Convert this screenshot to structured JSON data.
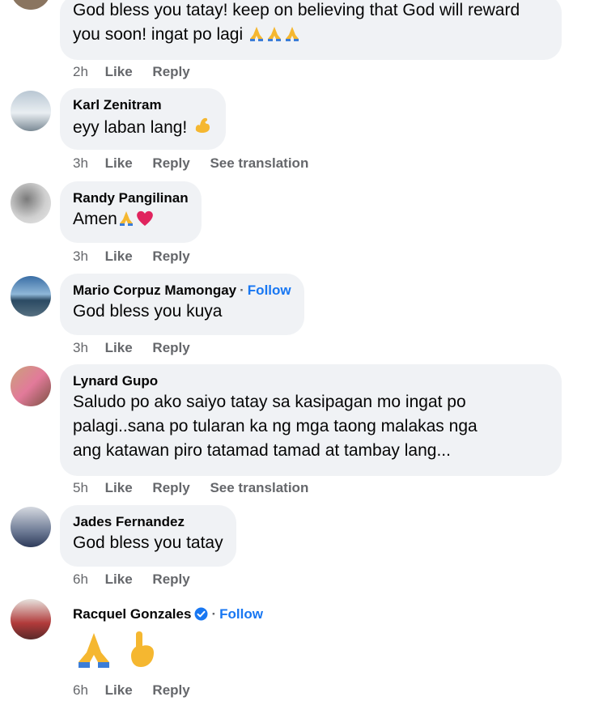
{
  "comments": [
    {
      "name": "",
      "text": "God bless you tatay! keep on believing that God will reward you soon! ingat po lagi",
      "time": "2h",
      "like": "Like",
      "reply": "Reply"
    },
    {
      "name": "Karl Zenitram",
      "text": "eyy laban lang!",
      "time": "3h",
      "like": "Like",
      "reply": "Reply",
      "translate": "See translation"
    },
    {
      "name": "Randy Pangilinan",
      "text": "Amen",
      "time": "3h",
      "like": "Like",
      "reply": "Reply"
    },
    {
      "name": "Mario Corpuz Mamongay",
      "follow": "Follow",
      "text": "God bless you kuya",
      "time": "3h",
      "like": "Like",
      "reply": "Reply"
    },
    {
      "name": "Lynard Gupo",
      "text_lines": [
        "Saludo po ako saiyo tatay sa kasipagan mo ingat po",
        "palagi..sana po tularan ka ng mga taong malakas nga",
        "ang katawan piro tatamad tamad at tambay lang..."
      ],
      "time": "5h",
      "like": "Like",
      "reply": "Reply",
      "translate": "See translation"
    },
    {
      "name": "Jades Fernandez",
      "text": "God bless you tatay",
      "time": "6h",
      "like": "Like",
      "reply": "Reply"
    },
    {
      "name": "Racquel Gonzales",
      "follow": "Follow",
      "time": "6h",
      "like": "Like",
      "reply": "Reply"
    }
  ],
  "separator": "·",
  "icons": {
    "praying": "praying-hands-icon",
    "heart": "red-heart-icon",
    "muscle": "flexed-biceps-icon",
    "pointing": "index-pointing-up-icon",
    "verified": "verified-badge-icon"
  },
  "colors": {
    "link": "#1877f2",
    "meta": "#65676b",
    "bubble": "#f0f2f5",
    "verified": "#1877f2",
    "heart": "#e0245e",
    "emoji": "#f5b730"
  }
}
